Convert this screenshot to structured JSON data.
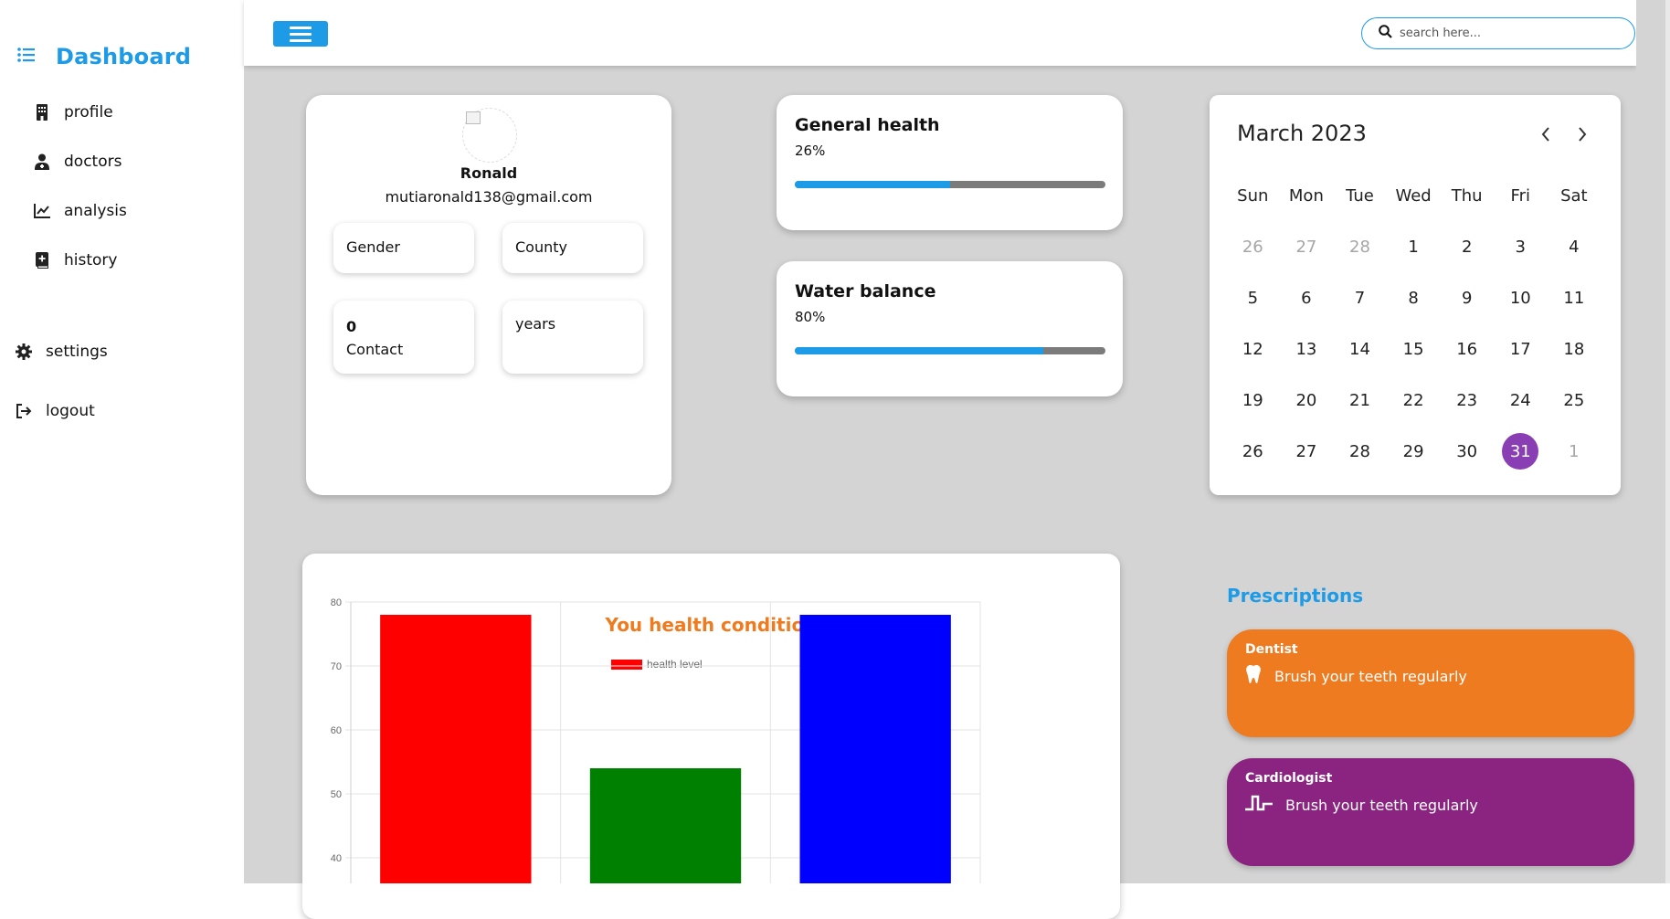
{
  "sidebar": {
    "title": "Dashboard",
    "items": [
      {
        "label": "profile",
        "icon": "building-icon"
      },
      {
        "label": "doctors",
        "icon": "user-doctor-icon"
      },
      {
        "label": "analysis",
        "icon": "chart-line-icon"
      },
      {
        "label": "history",
        "icon": "book-icon"
      }
    ],
    "settings_label": "settings",
    "logout_label": "logout"
  },
  "topbar": {
    "search_placeholder": "search here..."
  },
  "profile": {
    "name": "Ronald",
    "email": "mutiaronald138@gmail.com",
    "gender_label": "Gender",
    "county_label": "County",
    "contact_value": "0",
    "contact_label": "Contact",
    "years_label": "years"
  },
  "health": [
    {
      "title": "General health",
      "value": "26%",
      "progress": 0.5
    },
    {
      "title": "Water balance",
      "value": "80%",
      "progress": 0.8
    }
  ],
  "calendar": {
    "title": "March 2023",
    "weekdays": [
      "Sun",
      "Mon",
      "Tue",
      "Wed",
      "Thu",
      "Fri",
      "Sat"
    ],
    "days": [
      {
        "d": "26",
        "muted": true
      },
      {
        "d": "27",
        "muted": true
      },
      {
        "d": "28",
        "muted": true
      },
      {
        "d": "1"
      },
      {
        "d": "2"
      },
      {
        "d": "3"
      },
      {
        "d": "4"
      },
      {
        "d": "5"
      },
      {
        "d": "6"
      },
      {
        "d": "7"
      },
      {
        "d": "8"
      },
      {
        "d": "9"
      },
      {
        "d": "10"
      },
      {
        "d": "11"
      },
      {
        "d": "12"
      },
      {
        "d": "13"
      },
      {
        "d": "14"
      },
      {
        "d": "15"
      },
      {
        "d": "16"
      },
      {
        "d": "17"
      },
      {
        "d": "18"
      },
      {
        "d": "19"
      },
      {
        "d": "20"
      },
      {
        "d": "21"
      },
      {
        "d": "22"
      },
      {
        "d": "23"
      },
      {
        "d": "24"
      },
      {
        "d": "25"
      },
      {
        "d": "26"
      },
      {
        "d": "27"
      },
      {
        "d": "28"
      },
      {
        "d": "29"
      },
      {
        "d": "30"
      },
      {
        "d": "31",
        "today": true
      },
      {
        "d": "1",
        "muted": true
      }
    ]
  },
  "chart_data": {
    "type": "bar",
    "title": "You health condition",
    "categories": [
      "",
      "",
      ""
    ],
    "series": [
      {
        "name": "health level",
        "values": [
          78,
          54,
          78
        ],
        "colors": [
          "#ff0000",
          "#008000",
          "#0000ff"
        ]
      }
    ],
    "legend_color": "#ff0000",
    "yticks": [
      80,
      70,
      60,
      50,
      40
    ],
    "ylim": [
      36,
      80
    ],
    "grid": true,
    "legend": "top-center"
  },
  "prescriptions": {
    "title": "Prescriptions",
    "items": [
      {
        "doctor": "Dentist",
        "text": "Brush your teeth regularly",
        "icon": "tooth-icon",
        "color": "#ef7b20"
      },
      {
        "doctor": "Cardiologist",
        "text": "Brush your teeth regularly",
        "icon": "heartbeat-icon",
        "color": "#8a2480"
      }
    ]
  },
  "colors": {
    "accent": "#1d9be6",
    "today": "#8a3eb3",
    "background": "#d4d4d4"
  }
}
